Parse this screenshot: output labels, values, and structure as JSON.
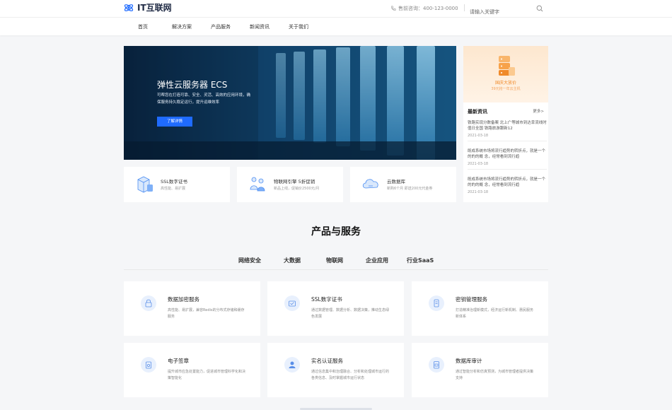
{
  "header": {
    "brand": "IT互联网",
    "hotline": "售前咨询：400-123-0000",
    "search_placeholder": "请输入关键字"
  },
  "nav": [
    "首页",
    "解决方案",
    "产品服务",
    "新闻资讯",
    "关于我们"
  ],
  "hero": {
    "title": "弹性云服务器 ECS",
    "description": "可帮您在打造可靠、安全、灵活、高效的应用环境，确保服务持久稳定运行，提升运维效率",
    "button": "了解详情"
  },
  "promo": {
    "title": "国庆大放价",
    "subtitle": "39元抢一年云主机"
  },
  "news": {
    "heading": "最新资讯",
    "more": "更多>",
    "items": [
      {
        "title": "铁路实现分数备案 北上广等城市到达幸流线时值日全国 铁路旅游跟新12",
        "date": "2021-03-18"
      },
      {
        "title": "既成系统市场将流行趋势的转折点，就是一个的的的概 念，经常看到流行趋",
        "date": "2021-03-18"
      },
      {
        "title": "既成系统市场将流行趋势的转折点，就是一个的的的概 念，经常看到流行趋",
        "date": "2021-03-18"
      }
    ]
  },
  "features": [
    {
      "title": "SSL数字证书",
      "subtitle": "高性能、易扩展"
    },
    {
      "title": "物联网引擎 5折促销",
      "subtitle": "新品上线，促销价2500元/月"
    },
    {
      "title": "云数据库",
      "subtitle": "新购6个月 即送200元代金券"
    }
  ],
  "section": {
    "title": "产品与服务",
    "tabs": [
      "网络安全",
      "大数据",
      "物联网",
      "企业应用",
      "行业SaaS"
    ]
  },
  "services": [
    {
      "title": "数据加密服务",
      "desc": "高性能、易扩展，兼容Redis的分布式存储和缓存服务",
      "icon": "lock-icon"
    },
    {
      "title": "SSL数字证书",
      "desc": "通过数据管理、数据分析、数据决策，推动生态绿色发展",
      "icon": "certificate-icon"
    },
    {
      "title": "密钥管理服务",
      "desc": "打造精准治理新模式，经济运行新机制、惠民服务新体系",
      "icon": "key-card-icon"
    },
    {
      "title": "电子签章",
      "desc": "提升城市应急处置能力，促进城市管理科学化和决策智能化",
      "icon": "seal-icon"
    },
    {
      "title": "实名认证服务",
      "desc": "通过信息集中和治理融合、分析和处理城市运行的各类信息、及时掌握城市运行状态",
      "icon": "user-verify-icon"
    },
    {
      "title": "数据库审计",
      "desc": "通过智能分析和仿真预测，为城市管理者提供决策支持",
      "icon": "audit-icon"
    }
  ],
  "colors": {
    "accent": "#1f6bff",
    "promo_orange": "#f08a2a",
    "icon_bg": "#e8f0fd"
  }
}
